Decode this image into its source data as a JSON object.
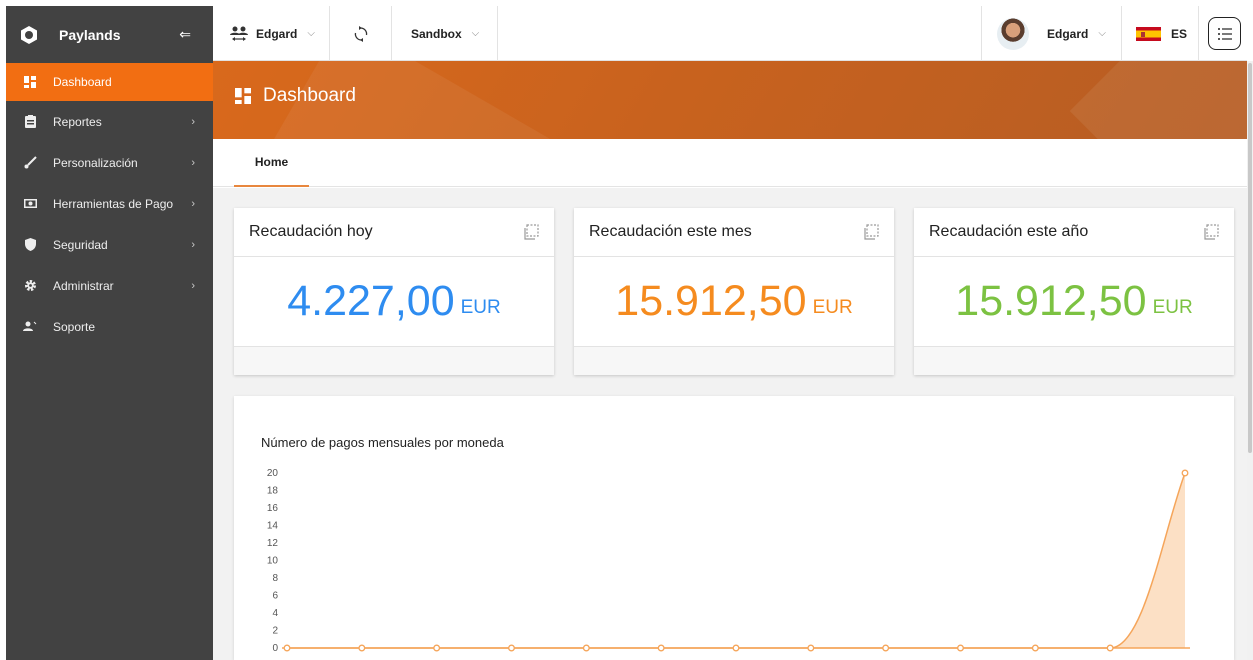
{
  "sidebar": {
    "brand": "Paylands",
    "items": [
      {
        "label": "Dashboard",
        "icon": "dashboard-icon",
        "active": true
      },
      {
        "label": "Reportes",
        "icon": "report-icon",
        "has_children": true
      },
      {
        "label": "Personalización",
        "icon": "brush-icon",
        "has_children": true
      },
      {
        "label": "Herramientas de Pago",
        "icon": "payment-tools-icon",
        "has_children": true
      },
      {
        "label": "Seguridad",
        "icon": "shield-icon",
        "has_children": true
      },
      {
        "label": "Administrar",
        "icon": "gear-icon",
        "has_children": true
      },
      {
        "label": "Soporte",
        "icon": "support-icon",
        "has_children": false
      }
    ]
  },
  "topbar": {
    "account": "Edgard",
    "environment": "Sandbox",
    "user": "Edgard",
    "language": "ES"
  },
  "banner": {
    "title": "Dashboard"
  },
  "tabs": [
    {
      "label": "Home",
      "active": true
    }
  ],
  "cards": [
    {
      "title": "Recaudación hoy",
      "amount": "4.227,00",
      "currency": "EUR",
      "color": "#2e8cf0"
    },
    {
      "title": "Recaudación este mes",
      "amount": "15.912,50",
      "currency": "EUR",
      "color": "#f58b1f"
    },
    {
      "title": "Recaudación este año",
      "amount": "15.912,50",
      "currency": "EUR",
      "color": "#7cc242"
    }
  ],
  "chart_data": {
    "type": "area",
    "title": "Número de pagos mensuales por moneda",
    "xlabel": "",
    "ylabel": "",
    "ylim": [
      0,
      20
    ],
    "y_ticks": [
      0,
      2,
      4,
      6,
      8,
      10,
      12,
      14,
      16,
      18,
      20
    ],
    "series": [
      {
        "values": [
          0,
          0,
          0,
          0,
          0,
          0,
          0,
          0,
          0,
          0,
          0,
          0,
          20
        ],
        "color": "#f5a55a"
      }
    ],
    "grid": false
  },
  "colors": {
    "accent": "#f26e12",
    "sidebar_bg": "#424242",
    "banner": "#c8621e"
  }
}
